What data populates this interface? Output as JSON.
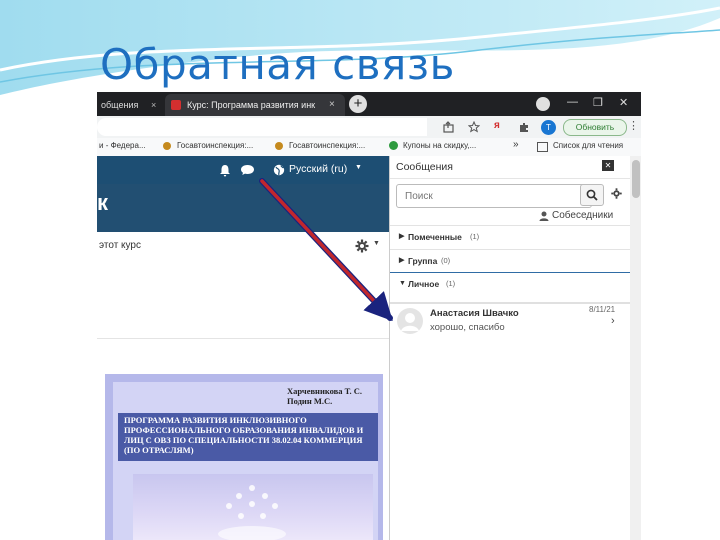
{
  "slide": {
    "title": "Обратная связь"
  },
  "browser": {
    "tabs": [
      {
        "label": "общения"
      },
      {
        "label": "Курс: Программа развития инк"
      }
    ],
    "tab_close": "×",
    "new_tab": "+",
    "window_controls": [
      "—",
      "❐",
      "✕"
    ],
    "toolbar": {
      "avatar_letter": "Т",
      "update_label": "Обновить",
      "menu_label": "⋮"
    },
    "bookmarks": [
      {
        "label": "и - Федера..."
      },
      {
        "label": "Госавтоинспекция:..."
      },
      {
        "label": "Госавтоинспекция:..."
      },
      {
        "label": "Купоны на скидку,..."
      },
      {
        "label": "Список для чтения"
      }
    ],
    "bookmarks_more": "»"
  },
  "site": {
    "header_letter": "к",
    "language": "Русский (ru)",
    "subnav_text": "этот курс"
  },
  "messages": {
    "title": "Сообщения",
    "close": "✕",
    "search_placeholder": "Поиск",
    "contacts_label": "Собеседники",
    "sections": [
      {
        "label": "Помеченные",
        "count": "(1)"
      },
      {
        "label": "Группа",
        "count": "(0)"
      },
      {
        "label": "Личное",
        "count": "(1)"
      }
    ],
    "conversation": {
      "name": "Анастасия Швачко",
      "preview": "хорошо, спасибо",
      "date": "8/11/21"
    }
  },
  "cover": {
    "authors": "Харчевникова Т. С.\nПодин М.С.",
    "program_title": "ПРОГРАММА РАЗВИТИЯ ИНКЛЮЗИВНОГО ПРОФЕССИОНАЛЬНОГО ОБРАЗОВАНИЯ ИНВАЛИДОВ И ЛИЦ С ОВЗ ПО СПЕЦИАЛЬНОСТИ 38.02.04 КОММЕРЦИЯ (ПО ОТРАСЛЯМ)"
  },
  "colors": {
    "title": "#1e6fc0",
    "site_header": "#1d4e73",
    "arrow": "#c1272d",
    "cover_band": "#4a5aa6"
  }
}
